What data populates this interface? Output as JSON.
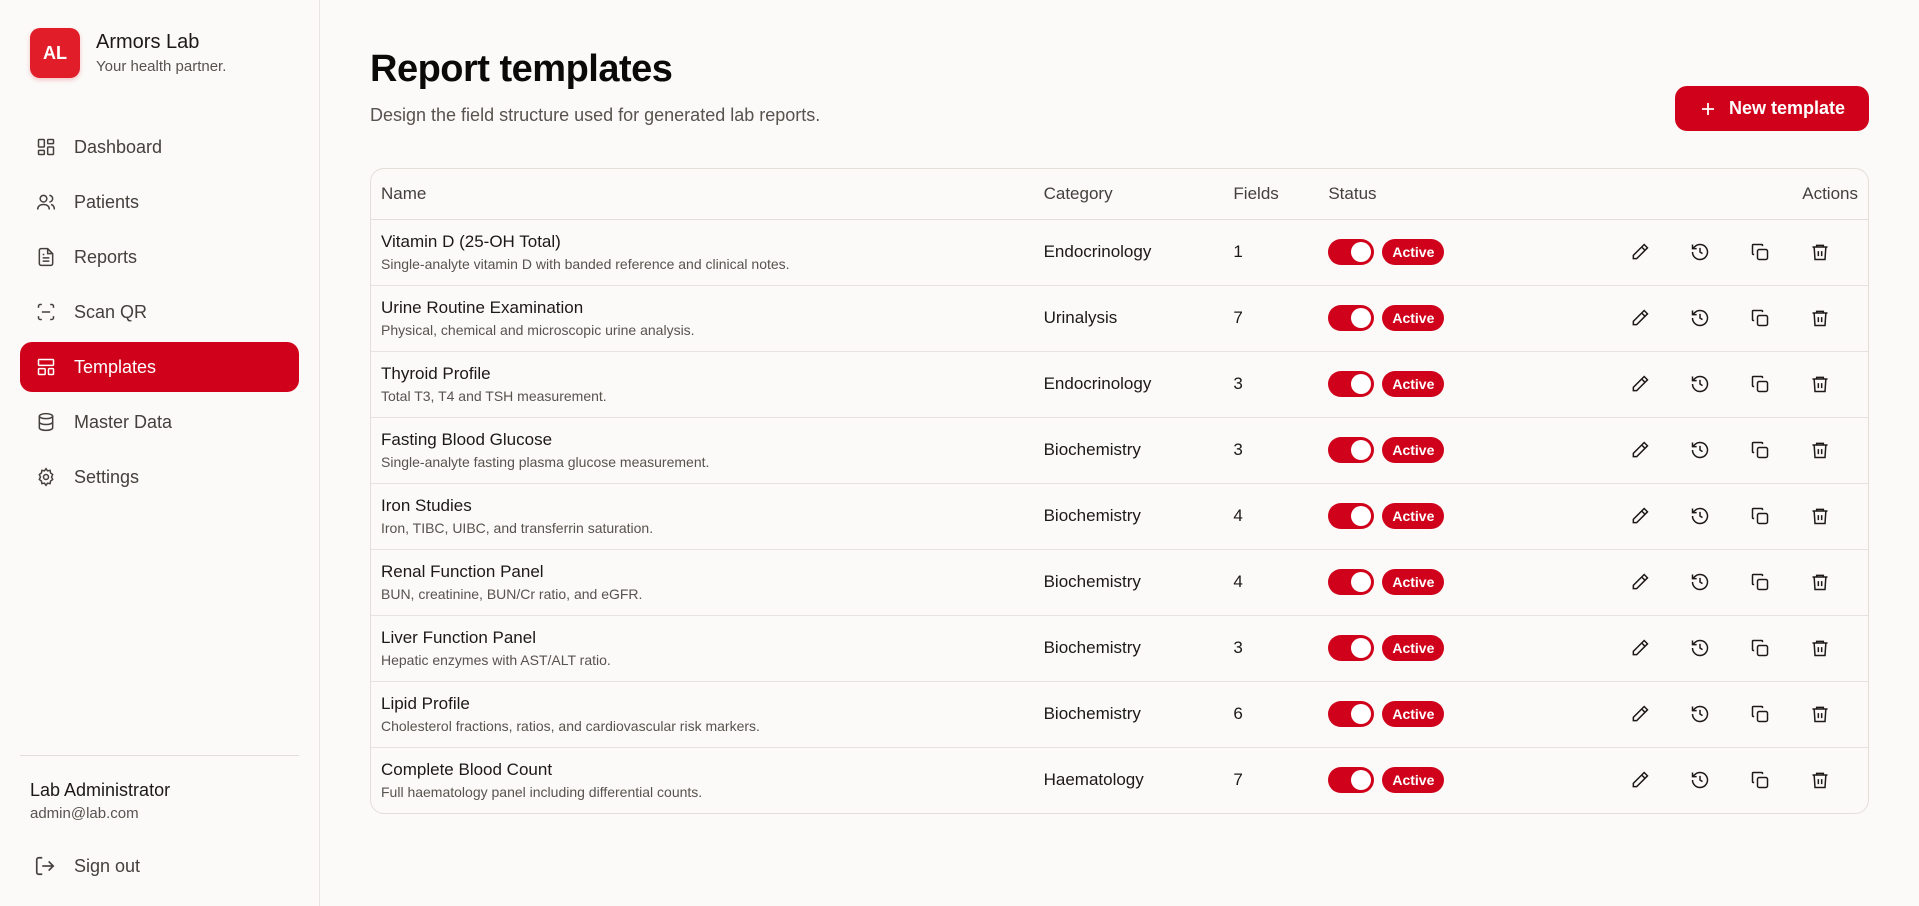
{
  "brand": {
    "initials": "AL",
    "name": "Armors Lab",
    "tagline": "Your health partner."
  },
  "nav": [
    {
      "label": "Dashboard",
      "icon": "dashboard-icon",
      "active": false
    },
    {
      "label": "Patients",
      "icon": "users-icon",
      "active": false
    },
    {
      "label": "Reports",
      "icon": "document-icon",
      "active": false
    },
    {
      "label": "Scan QR",
      "icon": "scan-icon",
      "active": false
    },
    {
      "label": "Templates",
      "icon": "layout-icon",
      "active": true
    },
    {
      "label": "Master Data",
      "icon": "database-icon",
      "active": false
    },
    {
      "label": "Settings",
      "icon": "gear-icon",
      "active": false
    }
  ],
  "user": {
    "name": "Lab Administrator",
    "email": "admin@lab.com",
    "signout": "Sign out"
  },
  "page": {
    "title": "Report templates",
    "subtitle": "Design the field structure used for generated lab reports.",
    "new_button": "New template"
  },
  "table": {
    "columns": {
      "name": "Name",
      "category": "Category",
      "fields": "Fields",
      "status": "Status",
      "actions": "Actions"
    },
    "rows": [
      {
        "name": "Vitamin D (25-OH Total)",
        "desc": "Single-analyte vitamin D with banded reference and clinical notes.",
        "category": "Endocrinology",
        "fields": "1",
        "status": "Active"
      },
      {
        "name": "Urine Routine Examination",
        "desc": "Physical, chemical and microscopic urine analysis.",
        "category": "Urinalysis",
        "fields": "7",
        "status": "Active"
      },
      {
        "name": "Thyroid Profile",
        "desc": "Total T3, T4 and TSH measurement.",
        "category": "Endocrinology",
        "fields": "3",
        "status": "Active"
      },
      {
        "name": "Fasting Blood Glucose",
        "desc": "Single-analyte fasting plasma glucose measurement.",
        "category": "Biochemistry",
        "fields": "3",
        "status": "Active"
      },
      {
        "name": "Iron Studies",
        "desc": "Iron, TIBC, UIBC, and transferrin saturation.",
        "category": "Biochemistry",
        "fields": "4",
        "status": "Active"
      },
      {
        "name": "Renal Function Panel",
        "desc": "BUN, creatinine, BUN/Cr ratio, and eGFR.",
        "category": "Biochemistry",
        "fields": "4",
        "status": "Active"
      },
      {
        "name": "Liver Function Panel",
        "desc": "Hepatic enzymes with AST/ALT ratio.",
        "category": "Biochemistry",
        "fields": "3",
        "status": "Active"
      },
      {
        "name": "Lipid Profile",
        "desc": "Cholesterol fractions, ratios, and cardiovascular risk markers.",
        "category": "Biochemistry",
        "fields": "6",
        "status": "Active"
      },
      {
        "name": "Complete Blood Count",
        "desc": "Full haematology panel including differential counts.",
        "category": "Haematology",
        "fields": "7",
        "status": "Active"
      }
    ]
  },
  "colors": {
    "accent": "#d0021b",
    "logo": "#e11d2a",
    "background": "#fbfaf8"
  }
}
